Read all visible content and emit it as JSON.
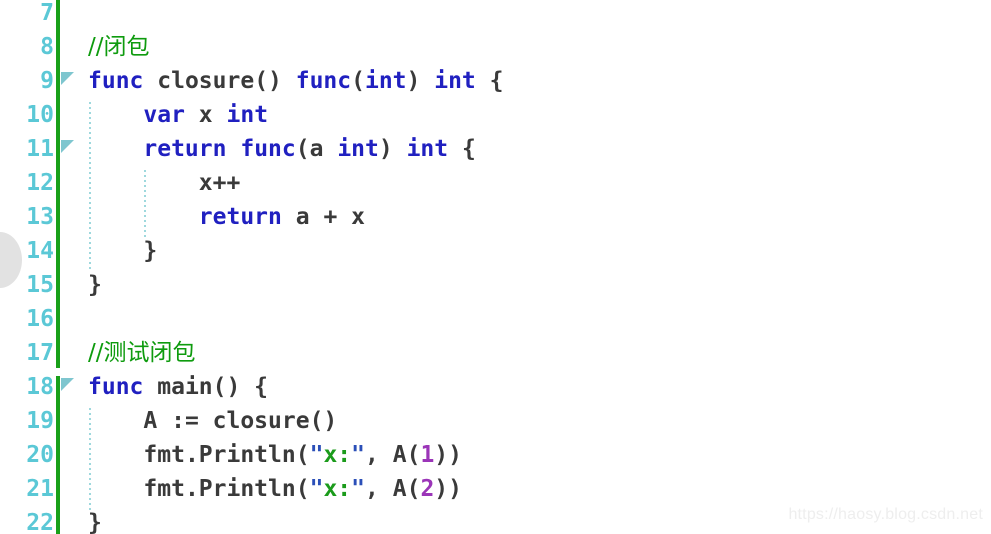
{
  "editor": {
    "language": "go",
    "background_color": "#ffffff",
    "line_number_color": "#5bc8d6",
    "change_bar_color": "#19a019",
    "fold_marker_color": "#7ec6cf",
    "indent_guide_color": "#9ed8dd",
    "first_line_number": 7,
    "last_line_number": 22,
    "line_height_px": 34
  },
  "colors": {
    "keyword": "#2020c0",
    "identifier": "#3a3a3a",
    "comment": "#0e9b0e",
    "string": "#1b9b1b",
    "number": "#9b35b8",
    "punctuation": "#3a3a3a"
  },
  "gutter": {
    "line_numbers": [
      "7",
      "8",
      "9",
      "10",
      "11",
      "12",
      "13",
      "14",
      "15",
      "16",
      "17",
      "18",
      "19",
      "20",
      "21",
      "22"
    ],
    "fold_marker_lines": [
      9,
      11,
      18
    ],
    "fold_marker_glyph": "collapse-triangle"
  },
  "lines": [
    {
      "n": "7",
      "indent": 0,
      "tokens": []
    },
    {
      "n": "8",
      "indent": 0,
      "tokens": [
        {
          "t": "comment",
          "v": "//闭包"
        }
      ]
    },
    {
      "n": "9",
      "indent": 0,
      "tokens": [
        {
          "t": "kw",
          "v": "func"
        },
        {
          "t": "plain",
          "v": " "
        },
        {
          "t": "ident",
          "v": "closure"
        },
        {
          "t": "punct",
          "v": "() "
        },
        {
          "t": "kw",
          "v": "func"
        },
        {
          "t": "punct",
          "v": "("
        },
        {
          "t": "kw",
          "v": "int"
        },
        {
          "t": "punct",
          "v": ") "
        },
        {
          "t": "kw",
          "v": "int"
        },
        {
          "t": "punct",
          "v": " {"
        }
      ]
    },
    {
      "n": "10",
      "indent": 1,
      "tokens": [
        {
          "t": "kw",
          "v": "var"
        },
        {
          "t": "plain",
          "v": " "
        },
        {
          "t": "ident",
          "v": "x"
        },
        {
          "t": "plain",
          "v": " "
        },
        {
          "t": "kw",
          "v": "int"
        }
      ]
    },
    {
      "n": "11",
      "indent": 1,
      "tokens": [
        {
          "t": "kw",
          "v": "return"
        },
        {
          "t": "plain",
          "v": " "
        },
        {
          "t": "kw",
          "v": "func"
        },
        {
          "t": "punct",
          "v": "("
        },
        {
          "t": "ident",
          "v": "a"
        },
        {
          "t": "plain",
          "v": " "
        },
        {
          "t": "kw",
          "v": "int"
        },
        {
          "t": "punct",
          "v": ") "
        },
        {
          "t": "kw",
          "v": "int"
        },
        {
          "t": "punct",
          "v": " {"
        }
      ]
    },
    {
      "n": "12",
      "indent": 2,
      "tokens": [
        {
          "t": "ident",
          "v": "x"
        },
        {
          "t": "punct",
          "v": "++"
        }
      ]
    },
    {
      "n": "13",
      "indent": 2,
      "tokens": [
        {
          "t": "kw",
          "v": "return"
        },
        {
          "t": "plain",
          "v": " "
        },
        {
          "t": "ident",
          "v": "a"
        },
        {
          "t": "punct",
          "v": " + "
        },
        {
          "t": "ident",
          "v": "x"
        }
      ]
    },
    {
      "n": "14",
      "indent": 1,
      "tokens": [
        {
          "t": "punct",
          "v": "}"
        }
      ]
    },
    {
      "n": "15",
      "indent": 0,
      "tokens": [
        {
          "t": "punct",
          "v": "}"
        }
      ]
    },
    {
      "n": "16",
      "indent": 0,
      "tokens": []
    },
    {
      "n": "17",
      "indent": 0,
      "tokens": [
        {
          "t": "comment",
          "v": "//测试闭包"
        }
      ]
    },
    {
      "n": "18",
      "indent": 0,
      "tokens": [
        {
          "t": "kw",
          "v": "func"
        },
        {
          "t": "plain",
          "v": " "
        },
        {
          "t": "ident",
          "v": "main"
        },
        {
          "t": "punct",
          "v": "() {"
        }
      ]
    },
    {
      "n": "19",
      "indent": 1,
      "tokens": [
        {
          "t": "ident",
          "v": "A"
        },
        {
          "t": "punct",
          "v": " := "
        },
        {
          "t": "ident",
          "v": "closure"
        },
        {
          "t": "punct",
          "v": "()"
        }
      ]
    },
    {
      "n": "20",
      "indent": 1,
      "tokens": [
        {
          "t": "ident",
          "v": "fmt"
        },
        {
          "t": "punct",
          "v": "."
        },
        {
          "t": "ident",
          "v": "Println"
        },
        {
          "t": "punct",
          "v": "("
        },
        {
          "t": "quote",
          "v": "\""
        },
        {
          "t": "str",
          "v": "x:"
        },
        {
          "t": "quote",
          "v": "\""
        },
        {
          "t": "punct",
          "v": ", "
        },
        {
          "t": "ident",
          "v": "A"
        },
        {
          "t": "punct",
          "v": "("
        },
        {
          "t": "num",
          "v": "1"
        },
        {
          "t": "punct",
          "v": "))"
        }
      ]
    },
    {
      "n": "21",
      "indent": 1,
      "tokens": [
        {
          "t": "ident",
          "v": "fmt"
        },
        {
          "t": "punct",
          "v": "."
        },
        {
          "t": "ident",
          "v": "Println"
        },
        {
          "t": "punct",
          "v": "("
        },
        {
          "t": "quote",
          "v": "\""
        },
        {
          "t": "str",
          "v": "x:"
        },
        {
          "t": "quote",
          "v": "\""
        },
        {
          "t": "punct",
          "v": ", "
        },
        {
          "t": "ident",
          "v": "A"
        },
        {
          "t": "punct",
          "v": "("
        },
        {
          "t": "num",
          "v": "2"
        },
        {
          "t": "punct",
          "v": "))"
        }
      ]
    },
    {
      "n": "22",
      "indent": 0,
      "tokens": [
        {
          "t": "punct",
          "v": "}"
        }
      ]
    }
  ],
  "watermark": {
    "text": "https://haosy.blog.csdn.net"
  }
}
